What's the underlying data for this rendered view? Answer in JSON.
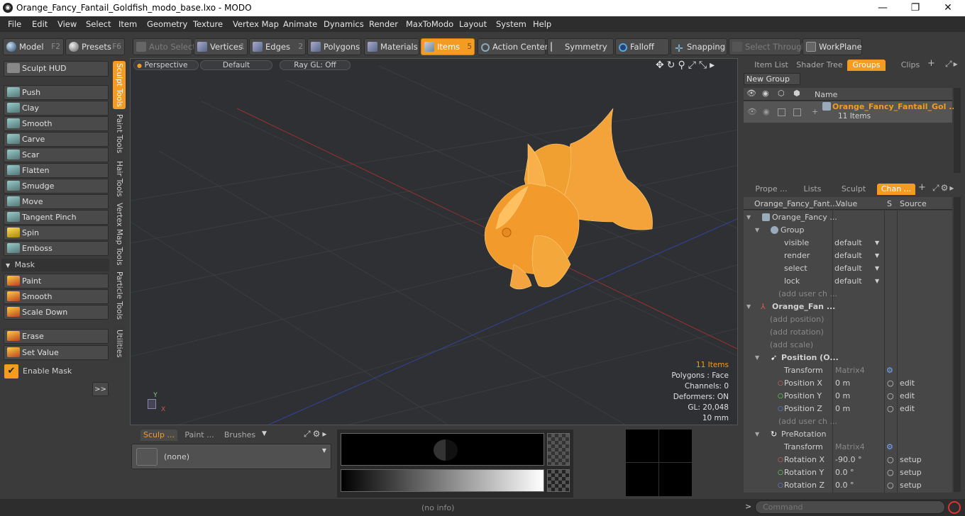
{
  "window": {
    "title": "Orange_Fancy_Fantail_Goldfish_modo_base.lxo - MODO",
    "minimize": "—",
    "maximize": "❐",
    "close": "✕"
  },
  "menu": [
    "File",
    "Edit",
    "View",
    "Select",
    "Item",
    "Geometry",
    "Texture",
    "Vertex Map",
    "Animate",
    "Dynamics",
    "Render",
    "MaxToModo",
    "Layout",
    "System",
    "Help"
  ],
  "toolbar": {
    "model": "Model",
    "model_key": "F2",
    "presets": "Presets",
    "presets_key": "F6",
    "auto_select": "Auto Select",
    "vertices": "Vertices",
    "vertices_key": "1",
    "edges": "Edges",
    "edges_key": "2",
    "polygons": "Polygons",
    "materials": "Materials",
    "items": "Items",
    "items_key": "5",
    "action_center": "Action Center",
    "symmetry": "Symmetry",
    "falloff": "Falloff",
    "snapping": "Snapping",
    "select_through": "Select Through",
    "workplane": "WorkPlane"
  },
  "sculpt": {
    "hud": "Sculpt HUD",
    "tools": [
      "Push",
      "Clay",
      "Smooth",
      "Carve",
      "Scar",
      "Flatten",
      "Smudge",
      "Move",
      "Tangent Pinch",
      "Spin",
      "Emboss"
    ],
    "mask_header": "Mask",
    "mask_tools": [
      "Paint",
      "Smooth",
      "Scale Down"
    ],
    "erase": "Erase",
    "set_value": "Set Value",
    "enable_mask": "Enable Mask",
    "expand": ">>"
  },
  "vtabs": [
    "Sculpt Tools",
    "Paint Tools",
    "Hair Tools",
    "Vertex Map Tools",
    "Particle Tools",
    "Utilities"
  ],
  "viewport": {
    "view": "Perspective",
    "style": "Default",
    "raygl": "Ray GL: Off",
    "info": {
      "items": "11 Items",
      "polygons": "Polygons : Face",
      "channels": "Channels: 0",
      "deformers": "Deformers: ON",
      "gl": "GL: 20,048",
      "scale": "10 mm"
    },
    "axes": {
      "y": "Y",
      "x": "X"
    }
  },
  "bottom": {
    "tabs": [
      "Sculp ...",
      "Paint ...",
      "Brushes"
    ],
    "brush": "(none)"
  },
  "status": {
    "info": "(no info)",
    "command_placeholder": "Command"
  },
  "groups_panel": {
    "tabs": [
      "Item List",
      "Shader Tree",
      "Groups",
      "Clips"
    ],
    "new_group": "New Group",
    "name_col": "Name",
    "group_name": "Orange_Fancy_Fantail_Gol ...",
    "group_count": "11 Items"
  },
  "channels_panel": {
    "tabs": [
      "Prope ...",
      "Lists",
      "Sculpt",
      "Chan ..."
    ],
    "headers": {
      "name": "Orange_Fancy_Fant...",
      "value": "Value",
      "s": "S",
      "source": "Source"
    },
    "rows": [
      {
        "name": "Orange_Fancy ...",
        "value": "",
        "source": ""
      },
      {
        "name": "Group",
        "value": "",
        "source": ""
      },
      {
        "name": "visible",
        "value": "default",
        "source": ""
      },
      {
        "name": "render",
        "value": "default",
        "source": ""
      },
      {
        "name": "select",
        "value": "default",
        "source": ""
      },
      {
        "name": "lock",
        "value": "default",
        "source": ""
      },
      {
        "name": "(add user ch ...",
        "value": "",
        "source": ""
      },
      {
        "name": "Orange_Fan ...",
        "value": "",
        "source": ""
      },
      {
        "name": "(add position)",
        "value": "",
        "source": ""
      },
      {
        "name": "(add rotation)",
        "value": "",
        "source": ""
      },
      {
        "name": "(add scale)",
        "value": "",
        "source": ""
      },
      {
        "name": "Position (O...",
        "value": "",
        "source": ""
      },
      {
        "name": "Transform",
        "value": "Matrix4",
        "source": ""
      },
      {
        "name": "Position X",
        "value": "0 m",
        "source": "edit"
      },
      {
        "name": "Position Y",
        "value": "0 m",
        "source": "edit"
      },
      {
        "name": "Position Z",
        "value": "0 m",
        "source": "edit"
      },
      {
        "name": "(add user ch ...",
        "value": "",
        "source": ""
      },
      {
        "name": "PreRotation",
        "value": "",
        "source": ""
      },
      {
        "name": "Transform",
        "value": "Matrix4",
        "source": ""
      },
      {
        "name": "Rotation X",
        "value": "-90.0 °",
        "source": "setup"
      },
      {
        "name": "Rotation Y",
        "value": "0.0 °",
        "source": "setup"
      },
      {
        "name": "Rotation Z",
        "value": "0.0 °",
        "source": "setup"
      }
    ]
  },
  "colors": {
    "accent": "#f39c21",
    "fish": "#f7a33a",
    "red_axis": "#b03030",
    "blue_axis": "#3040a0"
  }
}
